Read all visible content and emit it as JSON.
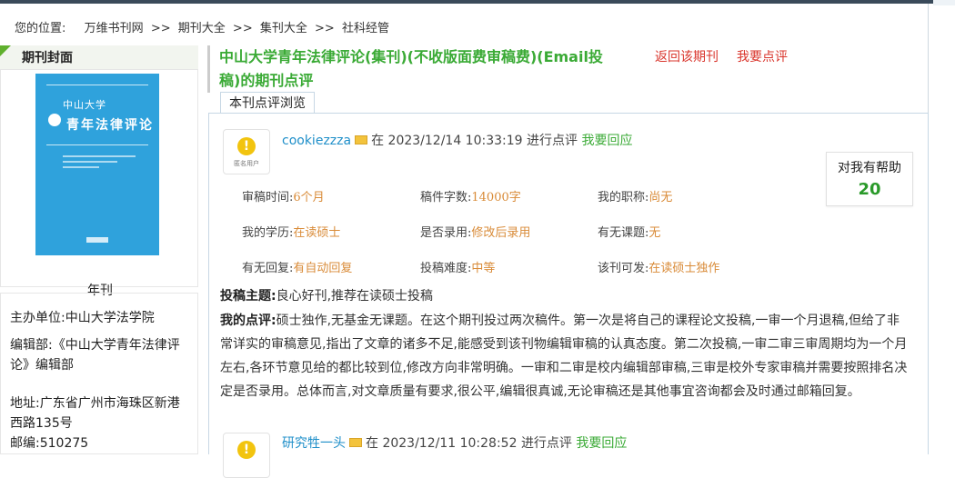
{
  "breadcrumb": {
    "prefix": "您的位置:",
    "items": [
      "万维书刊网",
      "期刊大全",
      "集刊大全",
      "社科经管"
    ],
    "separator": ">>"
  },
  "sidebar": {
    "header": "期刊封面",
    "cover_title_1": "中山大学",
    "cover_title_2": "青年法律评论",
    "frequency": "年刊",
    "sponsor_label": "主办单位:",
    "sponsor": "中山大学法学院",
    "editorial_label": "编辑部:",
    "editorial": "《中山大学青年法律评论》编辑部",
    "address_label": "地址:",
    "address": "广东省广州市海珠区新港西路135号",
    "postcode_label": "邮编:",
    "postcode": "510275"
  },
  "header": {
    "title_line1": "中山大学青年法律评论(集刊)(不收版面费审稿费)(Email投",
    "title_line2": "稿)的期刊点评",
    "return_link": "返回该期刊",
    "review_link": "我要点评"
  },
  "tab": {
    "label": "本刊点评浏览"
  },
  "reviews": [
    {
      "avatar_label": "匿名用户",
      "user": "cookiezzza",
      "in": "在",
      "datetime": "2023/12/14 10:33:19",
      "action": "进行点评",
      "reply": "我要回应",
      "helpful_label": "对我有帮助",
      "helpful_count": "20",
      "fields": [
        {
          "k": "审稿时间:",
          "v": "6个月"
        },
        {
          "k": "稿件字数:",
          "v": "14000字"
        },
        {
          "k": "我的职称:",
          "v": "尚无"
        },
        {
          "k": "我的学历:",
          "v": "在读硕士"
        },
        {
          "k": "是否录用:",
          "v": "修改后录用"
        },
        {
          "k": "有无课题:",
          "v": "无"
        },
        {
          "k": "有无回复:",
          "v": "有自动回复"
        },
        {
          "k": "投稿难度:",
          "v": "中等"
        },
        {
          "k": "该刊可发:",
          "v": "在读硕士独作"
        }
      ],
      "subject_label": "投稿主题:",
      "subject": "良心好刊,推荐在读硕士投稿",
      "comment_label": "我的点评:",
      "comment_lines": [
        "硕士独作,无基金无课题。在这个期刊投过两次稿件。第一次是将自己的课程论文投稿,一审一个月退稿,但给了非",
        "常详实的审稿意见,指出了文章的诸多不足,能感受到该刊物编辑审稿的认真态度。第二次投稿,一审二审三审周期均为一个月",
        "左右,各环节意见给的都比较到位,修改方向非常明确。一审和二审是校内编辑部审稿,三审是校外专家审稿并需要按照排名决",
        "定是否录用。总体而言,对文章质量有要求,很公平,编辑很真诚,无论审稿还是其他事宜咨询都会及时通过邮箱回复。"
      ]
    },
    {
      "user": "研究牲一头",
      "in": "在",
      "datetime": "2023/12/11 10:28:52",
      "action": "进行点评",
      "reply": "我要回应"
    }
  ],
  "colors": {
    "accent_green": "#3aaa35",
    "link_red": "#d9342b",
    "user_blue": "#1f8fc9",
    "value_orange": "#d98b38",
    "cover_blue": "#2fa2dc"
  }
}
